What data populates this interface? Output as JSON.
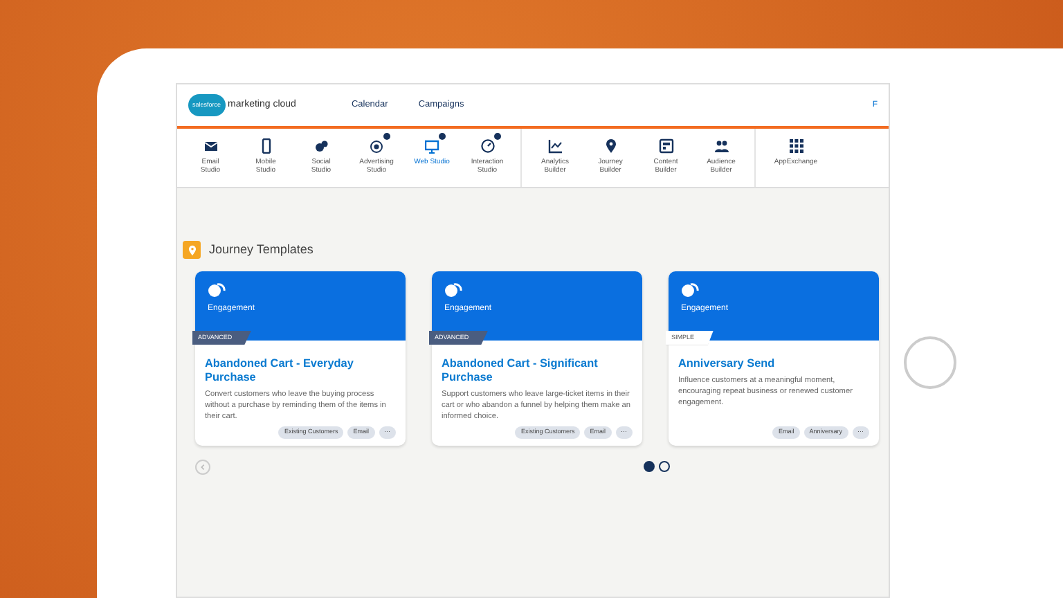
{
  "header": {
    "logo_badge": "salesforce",
    "product": "marketing cloud",
    "links": [
      {
        "label": "Calendar"
      },
      {
        "label": "Campaigns"
      }
    ],
    "cut_link": "F"
  },
  "nav_groups": [
    [
      {
        "label": "Email Studio",
        "selected": false,
        "badge": false
      },
      {
        "label": "Mobile Studio",
        "selected": false,
        "badge": false
      },
      {
        "label": "Social Studio",
        "selected": false,
        "badge": false
      },
      {
        "label": "Advertising Studio",
        "selected": false,
        "badge": true
      },
      {
        "label": "Web Studio",
        "selected": true,
        "badge": true
      },
      {
        "label": "Interaction Studio",
        "selected": false,
        "badge": true
      }
    ],
    [
      {
        "label": "Analytics Builder",
        "selected": false,
        "badge": false
      },
      {
        "label": "Journey Builder",
        "selected": false,
        "badge": false
      },
      {
        "label": "Content Builder",
        "selected": false,
        "badge": false
      },
      {
        "label": "Audience Builder",
        "selected": false,
        "badge": false
      }
    ],
    [
      {
        "label": "AppExchange",
        "selected": false,
        "badge": false
      }
    ]
  ],
  "section_title": "Journey Templates",
  "cards": [
    {
      "category": "Engagement",
      "ribbon": {
        "text": "ADVANCED",
        "kind": "dark"
      },
      "title": "Abandoned Cart - Everyday Purchase",
      "description": "Convert customers who leave the buying process without a purchase by reminding them of the items in their cart.",
      "tags": [
        "Existing Customers",
        "Email"
      ],
      "more": "···"
    },
    {
      "category": "Engagement",
      "ribbon": {
        "text": "ADVANCED",
        "kind": "dark"
      },
      "title": "Abandoned Cart - Significant Purchase",
      "description": "Support customers who leave large-ticket items in their cart or who abandon a funnel by helping them make an informed choice.",
      "tags": [
        "Existing Customers",
        "Email"
      ],
      "more": "···"
    },
    {
      "category": "Engagement",
      "ribbon": {
        "text": "SIMPLE",
        "kind": "light"
      },
      "title": "Anniversary Send",
      "description": "Influence customers at a meaningful moment, encouraging repeat business or renewed customer engagement.",
      "tags": [
        "Email",
        "Anniversary"
      ],
      "more": "···"
    }
  ],
  "pager": [
    {
      "selected": true
    },
    {
      "selected": false
    }
  ]
}
